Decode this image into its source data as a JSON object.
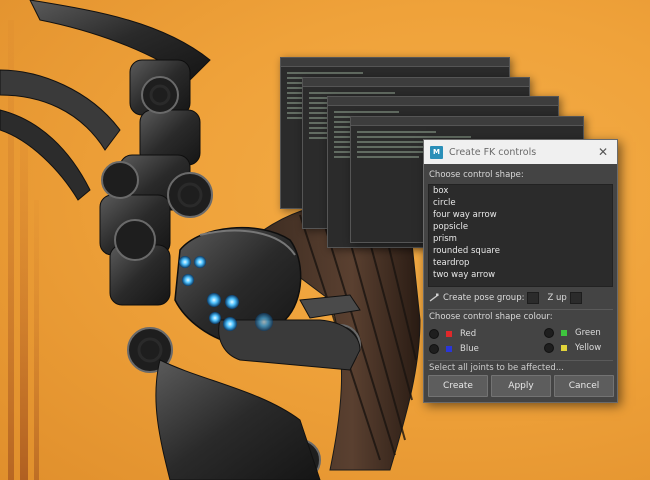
{
  "dialog": {
    "title": "Create FK controls",
    "app_icon_text": "M",
    "close_icon": "close-icon",
    "shape_label": "Choose control shape:",
    "shapes": [
      "box",
      "circle",
      "four way arrow",
      "popsicle",
      "prism",
      "rounded square",
      "teardrop",
      "two way arrow"
    ],
    "pose_group_label": "Create pose group:",
    "z_up_label": "Z up",
    "colour_label": "Choose control shape colour:",
    "colours": [
      {
        "name": "Red",
        "color": "#e0282a"
      },
      {
        "name": "Green",
        "color": "#3ec43e"
      },
      {
        "name": "Blue",
        "color": "#2a36d8"
      },
      {
        "name": "Yellow",
        "color": "#e2d43a"
      }
    ],
    "status": "Select all joints to be affected...",
    "buttons": {
      "create": "Create",
      "apply": "Apply",
      "cancel": "Cancel"
    }
  },
  "colors": {
    "background": "#efa23a",
    "dialog_bg": "#444444",
    "list_bg": "#2b2b2b",
    "titlebar_bg": "#f0f0f0",
    "robot_glow": "#4fc3ff"
  }
}
